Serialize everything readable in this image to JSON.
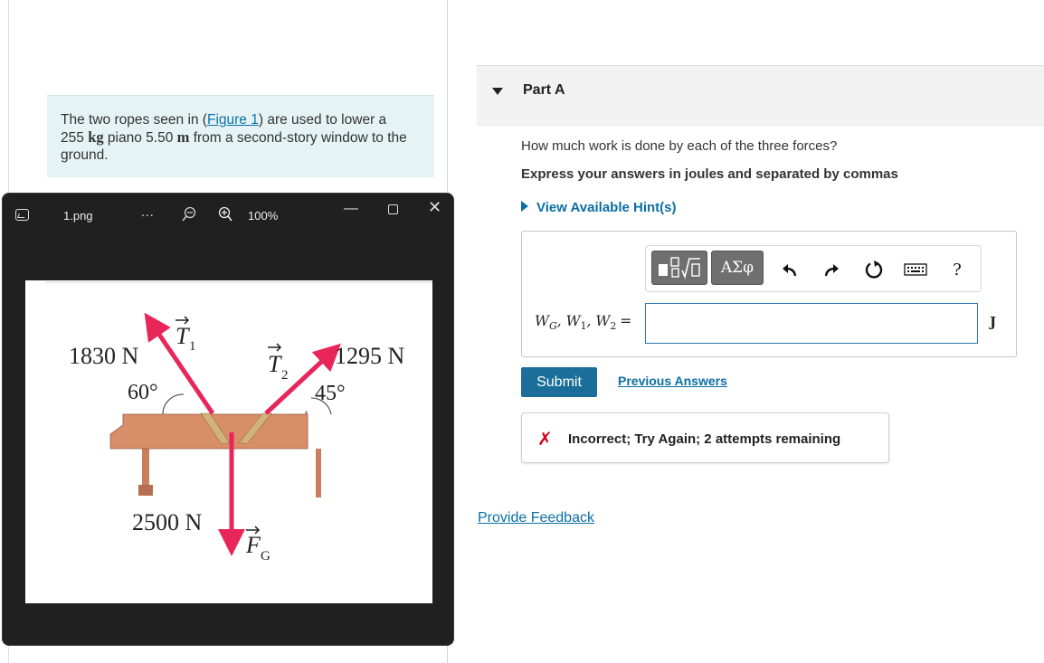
{
  "problem": {
    "text_before_link": "The two ropes seen in (",
    "link": "Figure 1",
    "text_after_link": ") are used to lower a",
    "mass_value": "255",
    "mass_unit": "kg",
    "text_mid": " piano 5.50 ",
    "dist_unit": "m",
    "text_end": " from a second-story window to the ground."
  },
  "part": {
    "title": "Part A",
    "question": "How much work is done by each of the three forces?",
    "instruction": "Express your answers in joules and separated by commas",
    "hints_label": "View Available Hint(s)"
  },
  "toolbar": {
    "greek_label": "ΑΣφ",
    "icons": [
      "templates-icon",
      "greek-letters-icon",
      "undo-icon",
      "redo-icon",
      "reset-icon",
      "keyboard-icon",
      "help-icon"
    ],
    "help_label": "?"
  },
  "answer": {
    "label_wg": "W",
    "label_wg_sub": "G",
    "label_w1": "W",
    "label_w1_sub": "1",
    "label_w2": "W",
    "label_w2_sub": "2",
    "equals": "=",
    "value": "",
    "unit": "J"
  },
  "actions": {
    "submit_label": "Submit",
    "previous_answers_label": "Previous Answers",
    "feedback_text": "Incorrect; Try Again; 2 attempts remaining",
    "provide_feedback_label": "Provide Feedback"
  },
  "viewer": {
    "file_name": "1.png",
    "more_label": "...",
    "zoom_level": "100%"
  },
  "figure": {
    "t1_magnitude": "1830 N",
    "t1_angle": "60°",
    "t1_label": "T",
    "t1_sub": "1",
    "t2_magnitude": "1295 N",
    "t2_angle": "45°",
    "t2_label": "T",
    "t2_sub": "2",
    "fg_magnitude": "2500 N",
    "fg_label": "F",
    "fg_sub": "G"
  },
  "colors": {
    "accent": "#1a6e99",
    "link": "#0b6fa4",
    "error": "#d0021b",
    "force_arrow": "#e8265a",
    "piano": "#d98e6a"
  }
}
